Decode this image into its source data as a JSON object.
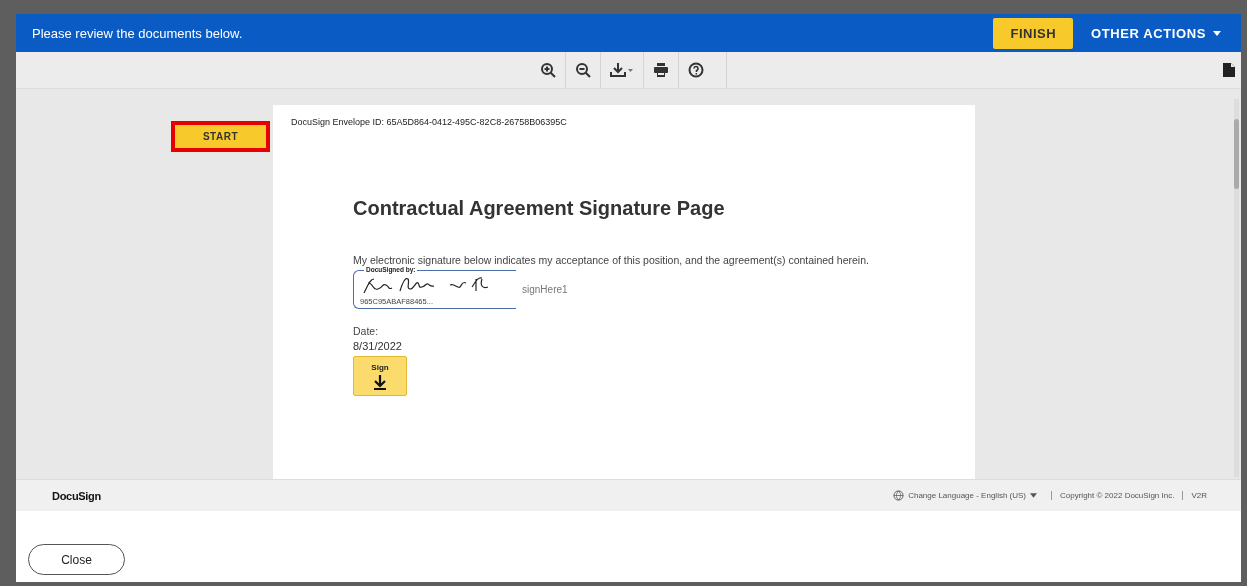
{
  "header": {
    "message": "Please review the documents below.",
    "finish": "FINISH",
    "other_actions": "OTHER ACTIONS"
  },
  "start": "START",
  "document": {
    "envelope_id": "DocuSign Envelope ID: 65A5D864-0412-495C-82C8-26758B06395C",
    "title": "Contractual Agreement Signature Page",
    "statement": "My electronic signature below indicates my acceptance of this position, and the agreement(s) contained herein.",
    "signed_by": "DocuSigned by:",
    "sign_here": "signHere1",
    "signature_id": "965C95ABAF88465...",
    "date_label": "Date:",
    "date": "8/31/2022",
    "sign_tag": "Sign"
  },
  "footer": {
    "brand": "DocuSign",
    "language": "Change Language - English (US)",
    "copyright": "Copyright © 2022 DocuSign Inc.",
    "version": "V2R"
  },
  "close": "Close"
}
